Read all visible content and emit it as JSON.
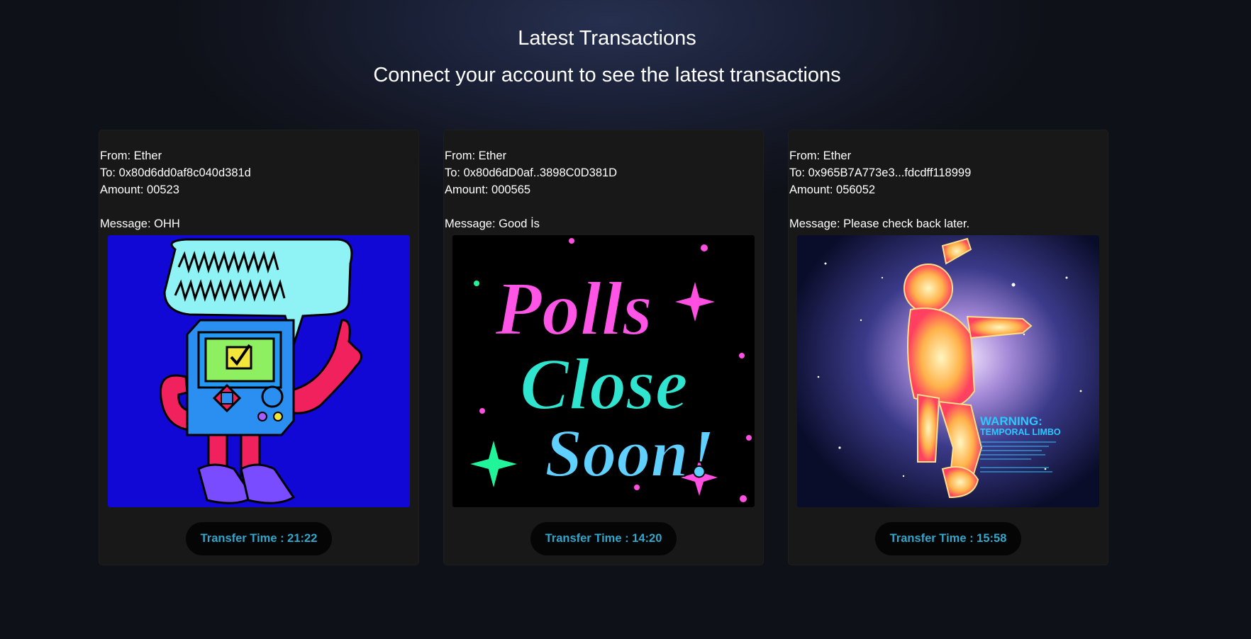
{
  "header": {
    "title": "Latest Transactions",
    "subtitle": "Connect your account to see the latest transactions"
  },
  "colors": {
    "background": "#121520",
    "card": "#181818",
    "pill": "#050505",
    "accent": "#33a5c9"
  },
  "transactions": [
    {
      "from": "From: Ether",
      "to": "To: 0x80d6dd0af8c040d381d",
      "amount": "Amount: 00523",
      "message": "Message: OHH",
      "image": "robot-ballot-illustration",
      "transfer_time": "Transfer Time : 21:22"
    },
    {
      "from": "From: Ether",
      "to": "To: 0x80d6dD0af..3898C0D381D",
      "amount": "Amount: 000565",
      "message": "Message: Good İs",
      "image": "polls-close-soon-illustration",
      "transfer_time": "Transfer Time : 14:20",
      "image_text": "Polls Close Soon!"
    },
    {
      "from": "From: Ether",
      "to": "To: 0x965B7A773e3...fdcdff118999",
      "amount": "Amount: 056052",
      "message": "Message: Please check back later.",
      "image": "astronaut-space-illustration",
      "transfer_time": "Transfer Time : 15:58",
      "image_text": "WARNING: TEMPORAL LIMBO"
    }
  ]
}
